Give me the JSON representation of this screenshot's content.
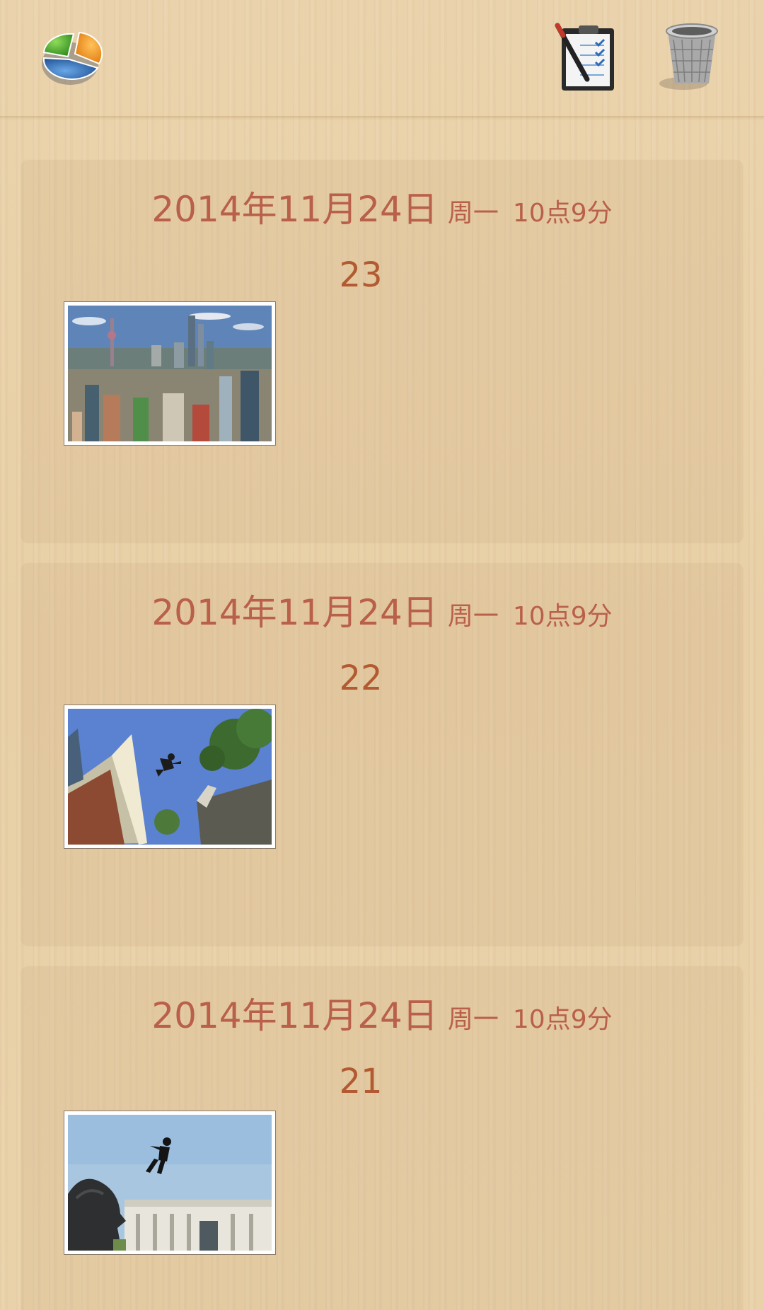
{
  "toolbar": {
    "left_icon": "pie-chart-icon",
    "right_icons": [
      "notes-clipboard-icon",
      "trash-bin-icon"
    ]
  },
  "entries": [
    {
      "date": "2014年11月24日",
      "weekday": "周一",
      "time": "10点9分",
      "title": "23",
      "thumbnail": "city-skyline-photo"
    },
    {
      "date": "2014年11月24日",
      "weekday": "周一",
      "time": "10点9分",
      "title": "22",
      "thumbnail": "parkour-jump-photo"
    },
    {
      "date": "2014年11月24日",
      "weekday": "周一",
      "time": "10点9分",
      "title": "21",
      "thumbnail": "lion-statue-jump-photo"
    }
  ],
  "colors": {
    "date_text": "#b9604a",
    "title_text": "#b25a32",
    "background": "#e8cfa6"
  }
}
